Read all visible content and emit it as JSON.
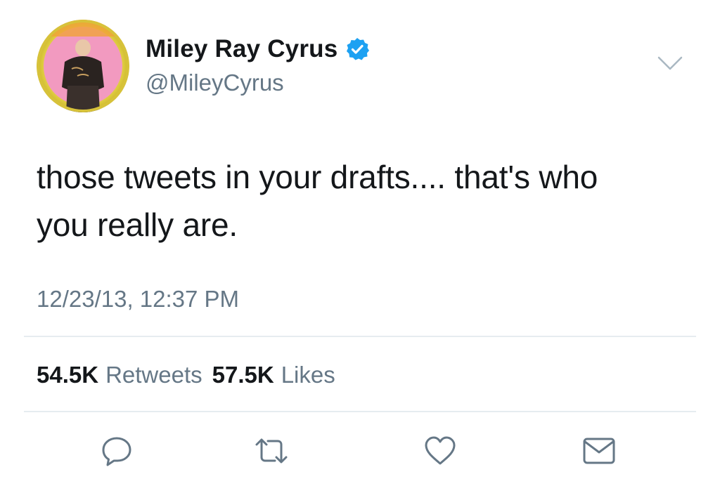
{
  "author": {
    "display_name": "Miley Ray Cyrus",
    "handle": "@MileyCyrus",
    "verified": true,
    "avatar_icon": "profile-photo"
  },
  "tweet": {
    "text_line1": "those tweets in your drafts.... that's who",
    "text_line2": "you really are.",
    "timestamp": "12/23/13, 12:37 PM"
  },
  "stats": {
    "retweets_count": "54.5K",
    "retweets_label": "Retweets",
    "likes_count": "57.5K",
    "likes_label": "Likes"
  },
  "actions": {
    "reply_icon": "reply-icon",
    "retweet_icon": "retweet-icon",
    "like_icon": "heart-icon",
    "dm_icon": "envelope-icon"
  },
  "colors": {
    "text_primary": "#14171a",
    "text_secondary": "#657786",
    "verified_blue": "#1da1f2",
    "divider": "#e6ecf0",
    "icon_gray": "#657786"
  }
}
